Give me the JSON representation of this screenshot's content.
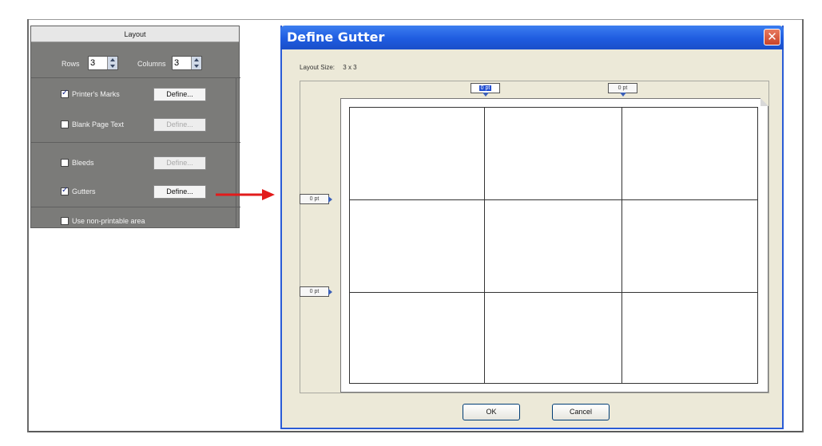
{
  "layout_panel": {
    "title": "Layout",
    "rows_label": "Rows",
    "rows_value": "3",
    "columns_label": "Columns",
    "columns_value": "3",
    "options": [
      {
        "label": "Printer's Marks",
        "checked": true,
        "button": "Define...",
        "button_enabled": true
      },
      {
        "label": "Blank Page Text",
        "checked": false,
        "button": "Define...",
        "button_enabled": false
      },
      {
        "label": "Bleeds",
        "checked": false,
        "button": "Define...",
        "button_enabled": false
      },
      {
        "label": "Gutters",
        "checked": true,
        "button": "Define...",
        "button_enabled": true
      },
      {
        "label": "Use non-printable area",
        "checked": false
      }
    ]
  },
  "dialog": {
    "title": "Define Gutter",
    "close_glyph": "✕",
    "layout_size_label": "Layout Size:",
    "layout_size_value": "3 x 3",
    "column_gutters": [
      "0 pt",
      "0 pt"
    ],
    "row_gutters": [
      "0 pt",
      "0 pt"
    ],
    "ok_label": "OK",
    "cancel_label": "Cancel"
  },
  "colors": {
    "panel_bg": "#7b7b79",
    "titlebar": "#1f5ce0",
    "arrow": "#e21b1b",
    "dialog_bg": "#ece9d8"
  }
}
